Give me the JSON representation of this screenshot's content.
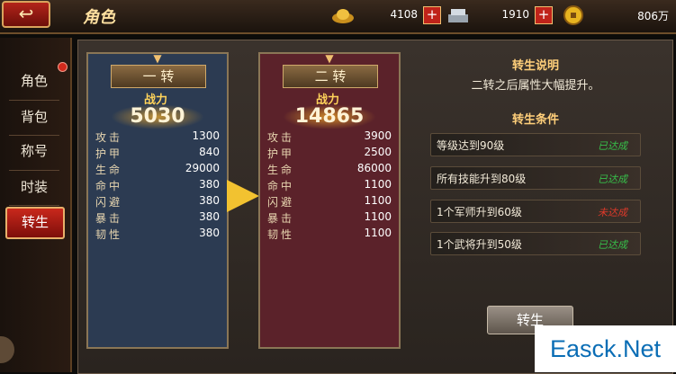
{
  "header": {
    "title": "角色",
    "back_icon": "back-arrow-icon",
    "resources": [
      {
        "name": "gold-ingot-icon",
        "value": "4108",
        "icon_color": "#e0b030"
      },
      {
        "name": "silver-ingot-icon",
        "value": "1910",
        "icon_color": "#c0c8d0"
      },
      {
        "name": "coin-icon",
        "value": "806万",
        "icon_color": "#e8b420"
      }
    ],
    "plus_label": "+"
  },
  "sidebar": {
    "items": [
      {
        "label": "角色",
        "active": false
      },
      {
        "label": "背包",
        "active": false
      },
      {
        "label": "称号",
        "active": false
      },
      {
        "label": "时装",
        "active": false
      },
      {
        "label": "转生",
        "active": true
      }
    ]
  },
  "stages": [
    {
      "title": "一 转",
      "power_label": "战力",
      "power": "5030",
      "stats": [
        {
          "name": "攻击",
          "value": "1300"
        },
        {
          "name": "护甲",
          "value": "840"
        },
        {
          "name": "生命",
          "value": "29000"
        },
        {
          "name": "命中",
          "value": "380"
        },
        {
          "name": "闪避",
          "value": "380"
        },
        {
          "name": "暴击",
          "value": "380"
        },
        {
          "name": "韧性",
          "value": "380"
        }
      ]
    },
    {
      "title": "二 转",
      "power_label": "战力",
      "power": "14865",
      "stats": [
        {
          "name": "攻击",
          "value": "3900"
        },
        {
          "name": "护甲",
          "value": "2500"
        },
        {
          "name": "生命",
          "value": "86000"
        },
        {
          "name": "命中",
          "value": "1100"
        },
        {
          "name": "闪避",
          "value": "1100"
        },
        {
          "name": "暴击",
          "value": "1100"
        },
        {
          "name": "韧性",
          "value": "1100"
        }
      ]
    }
  ],
  "info": {
    "desc_title": "转生说明",
    "desc": "二转之后属性大幅提升。",
    "cond_title": "转生条件",
    "conditions": [
      {
        "text": "等级达到90级",
        "status": "已达成",
        "met": true
      },
      {
        "text": "所有技能升到80级",
        "status": "已达成",
        "met": true
      },
      {
        "text": "1个军师升到60级",
        "status": "未达成",
        "met": false
      },
      {
        "text": "1个武将升到50级",
        "status": "已达成",
        "met": true
      }
    ]
  },
  "reborn_button": "转生",
  "watermark": "Easck.Net"
}
